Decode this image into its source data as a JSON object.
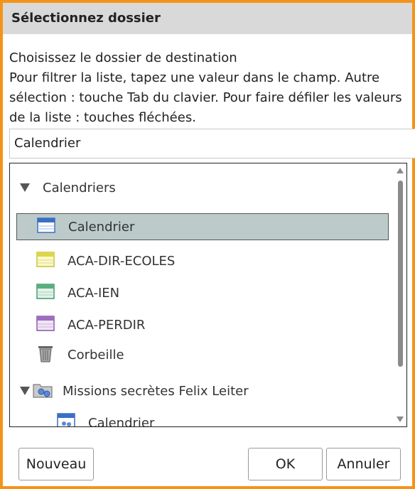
{
  "dialog": {
    "title": "Sélectionnez dossier",
    "description_lines": [
      "Choisissez le dossier de destination",
      "Pour filtrer la liste, tapez une valeur dans le champ. Autre",
      "sélection : touche Tab du clavier. Pour faire défiler les valeurs",
      "de la liste : touches fléchées."
    ],
    "filter_value": "Calendrier"
  },
  "tree": {
    "group_label": "Calendriers",
    "items": [
      {
        "label": "Calendrier",
        "icon": "calendar-blue-icon",
        "selected": true
      },
      {
        "label": "ACA-DIR-ECOLES",
        "icon": "calendar-yellow-icon"
      },
      {
        "label": "ACA-IEN",
        "icon": "calendar-green-icon"
      },
      {
        "label": "ACA-PERDIR",
        "icon": "calendar-purple-icon"
      },
      {
        "label": "Corbeille",
        "icon": "trash-icon"
      }
    ],
    "shared_group_label": "Missions secrètes Felix Leiter",
    "shared_child_label": "Calendrier"
  },
  "buttons": {
    "new_label": "Nouveau",
    "ok_label": "OK",
    "cancel_label": "Annuler"
  },
  "colors": {
    "border": "#f39417",
    "titlebar": "#d9d9d9",
    "selection": "#bccaca"
  }
}
